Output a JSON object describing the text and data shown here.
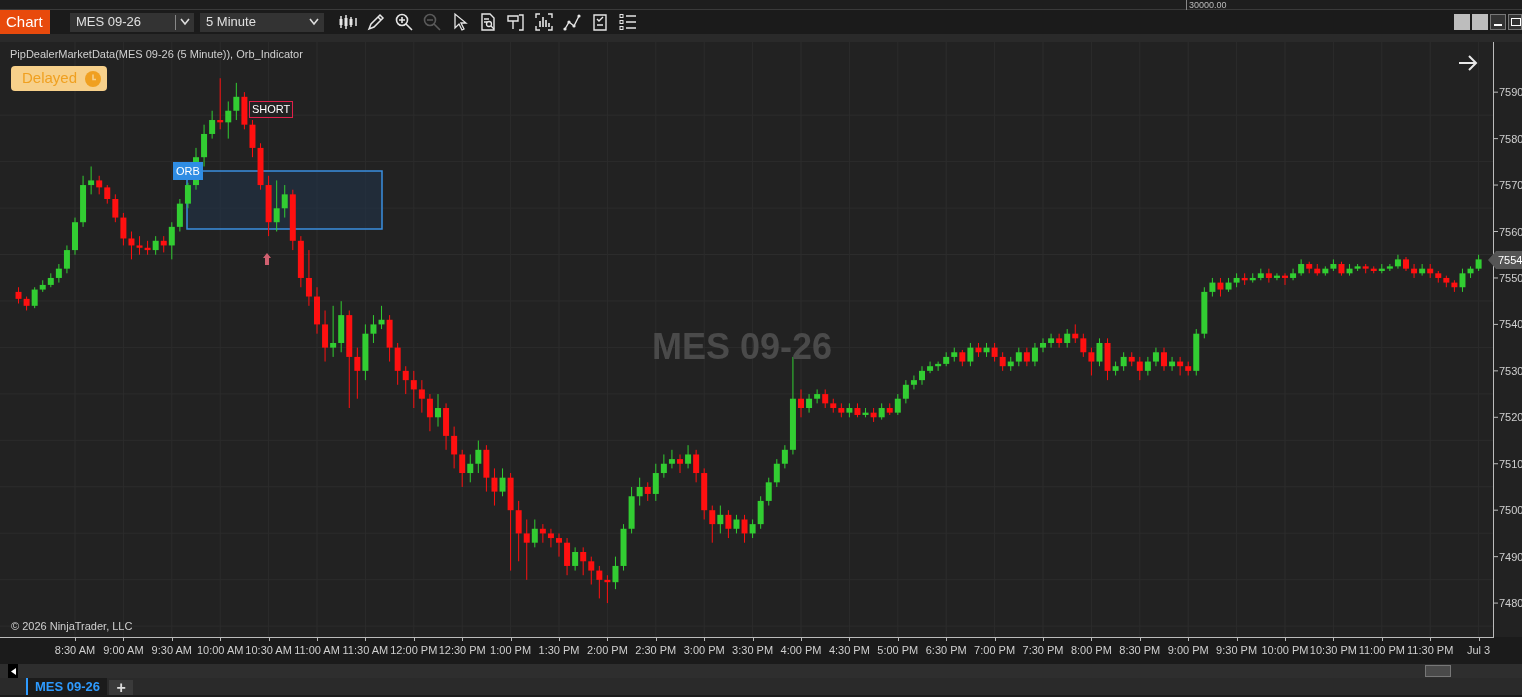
{
  "top_strip": {
    "value": "30000.00"
  },
  "toolbar": {
    "app_label": "Chart",
    "instrument": "MES 09-26",
    "interval": "5 Minute",
    "tools": [
      {
        "kind": "bars",
        "disabled": false
      },
      {
        "kind": "pencil",
        "disabled": false
      },
      {
        "kind": "zoom_in",
        "disabled": false
      },
      {
        "kind": "zoom_out",
        "disabled": true
      },
      {
        "kind": "pointer",
        "disabled": false
      },
      {
        "kind": "data_box",
        "disabled": false
      },
      {
        "kind": "properties",
        "disabled": false
      },
      {
        "kind": "templates",
        "disabled": false
      },
      {
        "kind": "strategies",
        "disabled": false
      },
      {
        "kind": "indicators",
        "disabled": false
      },
      {
        "kind": "list",
        "disabled": false
      }
    ]
  },
  "chart": {
    "title": "PipDealerMarketData(MES 09-26 (5 Minute)), Orb_Indicator",
    "status_badge": "Delayed",
    "watermark": "MES 09-26",
    "copyright": "© 2026 NinjaTrader, LLC",
    "orb_label": "ORB",
    "signal_label": "SHORT",
    "last_price": "7554",
    "chart_data": {
      "type": "candlestick",
      "ylim": [
        7472.7,
        7600.8
      ],
      "categories": [
        null,
        null,
        null,
        null,
        null,
        null,
        null,
        "8:30 AM",
        null,
        null,
        null,
        null,
        null,
        "9:00 AM",
        null,
        null,
        null,
        null,
        null,
        "9:30 AM",
        null,
        null,
        null,
        null,
        null,
        "10:00 AM",
        null,
        null,
        null,
        null,
        null,
        "10:30 AM",
        null,
        null,
        null,
        null,
        null,
        "11:00 AM",
        null,
        null,
        null,
        null,
        null,
        "11:30 AM",
        null,
        null,
        null,
        null,
        null,
        "12:00 PM",
        null,
        null,
        null,
        null,
        null,
        "12:30 PM",
        null,
        null,
        null,
        null,
        null,
        "1:00 PM",
        null,
        null,
        null,
        null,
        null,
        "1:30 PM",
        null,
        null,
        null,
        null,
        null,
        "2:00 PM",
        null,
        null,
        null,
        null,
        null,
        "2:30 PM",
        null,
        null,
        null,
        null,
        null,
        "3:00 PM",
        null,
        null,
        null,
        null,
        null,
        "3:30 PM",
        null,
        null,
        null,
        null,
        null,
        "4:00 PM",
        null,
        null,
        null,
        null,
        null,
        "4:30 PM",
        null,
        null,
        null,
        null,
        null,
        "5:00 PM",
        null,
        null,
        null,
        null,
        null,
        "6:30 PM",
        null,
        null,
        null,
        null,
        null,
        "7:00 PM",
        null,
        null,
        null,
        null,
        null,
        "7:30 PM",
        null,
        null,
        null,
        null,
        null,
        "8:00 PM",
        null,
        null,
        null,
        null,
        null,
        "8:30 PM",
        null,
        null,
        null,
        null,
        null,
        "9:00 PM",
        null,
        null,
        null,
        null,
        null,
        "9:30 PM",
        null,
        null,
        null,
        null,
        null,
        "10:00 PM",
        null,
        null,
        null,
        null,
        null,
        "10:30 PM",
        null,
        null,
        null,
        null,
        null,
        "11:00 PM",
        null,
        null,
        null,
        null,
        null,
        "11:30 PM",
        null,
        null,
        null,
        null,
        null,
        "Jul 3"
      ],
      "yticks": [
        7590,
        7580,
        7570,
        7560,
        7550,
        7540,
        7530,
        7520,
        7510,
        7500,
        7490,
        7480
      ],
      "ohlc": [
        [
          7547,
          7548,
          7544.5,
          7545.5
        ],
        [
          7545.5,
          7546,
          7543,
          7544
        ],
        [
          7544,
          7548,
          7543.5,
          7547.5
        ],
        [
          7547.5,
          7549.5,
          7547,
          7548.5
        ],
        [
          7548.5,
          7551,
          7548,
          7550
        ],
        [
          7550,
          7553,
          7549,
          7552
        ],
        [
          7552,
          7557,
          7551,
          7556
        ],
        [
          7556,
          7563,
          7555,
          7562
        ],
        [
          7562,
          7572,
          7561,
          7570
        ],
        [
          7570,
          7574,
          7568,
          7571
        ],
        [
          7571,
          7572,
          7568,
          7569.5
        ],
        [
          7569.5,
          7570,
          7566,
          7567
        ],
        [
          7567,
          7568,
          7562,
          7563
        ],
        [
          7563,
          7564,
          7557,
          7558.5
        ],
        [
          7558.5,
          7560,
          7554,
          7557
        ],
        [
          7557,
          7559,
          7555,
          7556.5
        ],
        [
          7556.5,
          7558,
          7555,
          7556
        ],
        [
          7556,
          7559,
          7555,
          7558
        ],
        [
          7558,
          7559,
          7555.5,
          7557
        ],
        [
          7557,
          7562,
          7554,
          7561
        ],
        [
          7561,
          7567,
          7560,
          7566
        ],
        [
          7566,
          7570.5,
          7565,
          7570
        ],
        [
          7570,
          7578,
          7569,
          7576
        ],
        [
          7576,
          7583,
          7574,
          7581
        ],
        [
          7581,
          7586,
          7580,
          7584
        ],
        [
          7584,
          7593,
          7582,
          7583.5
        ],
        [
          7583.5,
          7588,
          7580,
          7586
        ],
        [
          7586,
          7592,
          7584,
          7589
        ],
        [
          7589,
          7590,
          7582,
          7583
        ],
        [
          7583,
          7584,
          7576,
          7578
        ],
        [
          7578,
          7579,
          7569,
          7570
        ],
        [
          7570,
          7572,
          7559,
          7562
        ],
        [
          7562,
          7571,
          7560,
          7565
        ],
        [
          7565,
          7570,
          7563,
          7568
        ],
        [
          7568,
          7569,
          7556,
          7558
        ],
        [
          7558,
          7559,
          7548,
          7550
        ],
        [
          7550,
          7556,
          7544,
          7546
        ],
        [
          7546,
          7548,
          7538,
          7540
        ],
        [
          7540,
          7543,
          7532,
          7535
        ],
        [
          7535,
          7544,
          7533,
          7536
        ],
        [
          7536,
          7545,
          7534,
          7542
        ],
        [
          7542,
          7543,
          7522,
          7533
        ],
        [
          7533,
          7535,
          7524,
          7530
        ],
        [
          7530,
          7540,
          7528,
          7538
        ],
        [
          7538,
          7542,
          7536,
          7540
        ],
        [
          7540,
          7544,
          7539,
          7541
        ],
        [
          7541,
          7542,
          7532,
          7535
        ],
        [
          7535,
          7536,
          7527,
          7530
        ],
        [
          7530,
          7531,
          7525,
          7528
        ],
        [
          7528,
          7530,
          7522,
          7526
        ],
        [
          7526,
          7528,
          7521,
          7524
        ],
        [
          7524,
          7525,
          7517,
          7520
        ],
        [
          7520,
          7525,
          7518,
          7522
        ],
        [
          7522,
          7523,
          7513,
          7516
        ],
        [
          7516,
          7518,
          7509,
          7512
        ],
        [
          7512,
          7513,
          7505,
          7508
        ],
        [
          7508,
          7512,
          7506,
          7510
        ],
        [
          7510,
          7515,
          7508,
          7513
        ],
        [
          7513,
          7514,
          7504,
          7507
        ],
        [
          7507,
          7509,
          7501,
          7504
        ],
        [
          7504,
          7509,
          7503,
          7507
        ],
        [
          7507,
          7508,
          7487,
          7500
        ],
        [
          7500,
          7502,
          7489,
          7495
        ],
        [
          7495,
          7498,
          7485,
          7493
        ],
        [
          7493,
          7498,
          7492,
          7496
        ],
        [
          7496,
          7497,
          7493,
          7495
        ],
        [
          7495,
          7496,
          7492,
          7494
        ],
        [
          7494,
          7495,
          7490,
          7493
        ],
        [
          7493,
          7494,
          7486,
          7488
        ],
        [
          7488,
          7492,
          7487,
          7491
        ],
        [
          7491,
          7492,
          7486,
          7489
        ],
        [
          7489,
          7490,
          7484,
          7487
        ],
        [
          7487,
          7488,
          7481,
          7485
        ],
        [
          7485,
          7486,
          7480,
          7484.5
        ],
        [
          7484.5,
          7490,
          7483,
          7488
        ],
        [
          7488,
          7497,
          7487,
          7496
        ],
        [
          7496,
          7505,
          7495,
          7503
        ],
        [
          7503,
          7507,
          7501,
          7505
        ],
        [
          7505,
          7506,
          7502,
          7503.5
        ],
        [
          7503.5,
          7510,
          7502,
          7508
        ],
        [
          7508,
          7512,
          7507,
          7510
        ],
        [
          7510,
          7513,
          7509,
          7511
        ],
        [
          7511,
          7512,
          7508,
          7510
        ],
        [
          7510,
          7514,
          7509,
          7512
        ],
        [
          7512,
          7513,
          7506,
          7508
        ],
        [
          7508,
          7509,
          7498,
          7500
        ],
        [
          7500,
          7501,
          7493,
          7497
        ],
        [
          7497,
          7501,
          7495,
          7499
        ],
        [
          7499,
          7500,
          7494,
          7496
        ],
        [
          7496,
          7499,
          7495,
          7498
        ],
        [
          7498,
          7499,
          7493,
          7495
        ],
        [
          7495,
          7498,
          7494,
          7497
        ],
        [
          7497,
          7503,
          7496,
          7502
        ],
        [
          7502,
          7507,
          7501,
          7506
        ],
        [
          7506,
          7511,
          7505,
          7510
        ],
        [
          7510,
          7514,
          7509,
          7513
        ],
        [
          7513,
          7533,
          7512,
          7524
        ],
        [
          7524,
          7526,
          7520,
          7522
        ],
        [
          7522,
          7525,
          7521,
          7524
        ],
        [
          7524,
          7526,
          7523,
          7525
        ],
        [
          7525,
          7526,
          7522,
          7523
        ],
        [
          7523,
          7524,
          7521,
          7522
        ],
        [
          7522,
          7523,
          7520,
          7521
        ],
        [
          7521,
          7523,
          7520,
          7522
        ],
        [
          7522,
          7523,
          7520,
          7520.5
        ],
        [
          7520.5,
          7522,
          7520,
          7521
        ],
        [
          7521,
          7522,
          7519,
          7520
        ],
        [
          7520,
          7523,
          7519.5,
          7522
        ],
        [
          7522,
          7523,
          7520.5,
          7521
        ],
        [
          7521,
          7525,
          7520.5,
          7524
        ],
        [
          7524,
          7528,
          7523,
          7527
        ],
        [
          7527,
          7529,
          7526,
          7528
        ],
        [
          7528,
          7531,
          7527,
          7530
        ],
        [
          7530,
          7532,
          7529.5,
          7531
        ],
        [
          7531,
          7532,
          7530,
          7531.5
        ],
        [
          7531.5,
          7534,
          7531,
          7533
        ],
        [
          7533,
          7535,
          7532,
          7534
        ],
        [
          7534,
          7534.5,
          7531,
          7532
        ],
        [
          7532,
          7536,
          7531,
          7535
        ],
        [
          7535,
          7536,
          7533,
          7534
        ],
        [
          7534,
          7536,
          7533,
          7535
        ],
        [
          7535,
          7536,
          7532,
          7533
        ],
        [
          7533,
          7534,
          7530,
          7531
        ],
        [
          7531,
          7533,
          7530,
          7532
        ],
        [
          7532,
          7535,
          7531,
          7534
        ],
        [
          7534,
          7535,
          7531,
          7532
        ],
        [
          7532,
          7536,
          7531,
          7535
        ],
        [
          7535,
          7537,
          7534,
          7536
        ],
        [
          7536,
          7538,
          7535,
          7537
        ],
        [
          7537,
          7538,
          7535,
          7536
        ],
        [
          7536,
          7539,
          7535,
          7538
        ],
        [
          7538,
          7540,
          7536,
          7537
        ],
        [
          7537,
          7538,
          7533,
          7534
        ],
        [
          7534,
          7535,
          7529,
          7532
        ],
        [
          7532,
          7537,
          7531,
          7536
        ],
        [
          7536,
          7537,
          7528,
          7530
        ],
        [
          7530,
          7532,
          7529,
          7531
        ],
        [
          7531,
          7534,
          7530,
          7533
        ],
        [
          7533,
          7534,
          7531,
          7532
        ],
        [
          7532,
          7533,
          7528,
          7530
        ],
        [
          7530,
          7533,
          7529,
          7532
        ],
        [
          7532,
          7535,
          7531,
          7534
        ],
        [
          7534,
          7535,
          7530,
          7531
        ],
        [
          7531,
          7533,
          7530,
          7532
        ],
        [
          7532,
          7533,
          7529,
          7531
        ],
        [
          7531,
          7532,
          7529,
          7530
        ],
        [
          7530,
          7539,
          7529,
          7538
        ],
        [
          7538,
          7548,
          7537,
          7547
        ],
        [
          7547,
          7550,
          7546,
          7549
        ],
        [
          7549,
          7550,
          7546,
          7547.5
        ],
        [
          7547.5,
          7550,
          7547,
          7549
        ],
        [
          7549,
          7551,
          7548,
          7550
        ],
        [
          7550,
          7551,
          7548.5,
          7549.5
        ],
        [
          7549.5,
          7551,
          7549,
          7550
        ],
        [
          7550,
          7552,
          7549.5,
          7551
        ],
        [
          7551,
          7552,
          7549,
          7550
        ],
        [
          7550,
          7551,
          7549.5,
          7550.5
        ],
        [
          7550.5,
          7551,
          7548.5,
          7550
        ],
        [
          7550,
          7552,
          7549.5,
          7551
        ],
        [
          7551,
          7554,
          7550.5,
          7553
        ],
        [
          7553,
          7553.5,
          7551,
          7552
        ],
        [
          7552,
          7553,
          7550.5,
          7551
        ],
        [
          7551,
          7552.5,
          7550.5,
          7552
        ],
        [
          7552,
          7554,
          7551.5,
          7553
        ],
        [
          7553,
          7553.5,
          7550.5,
          7551
        ],
        [
          7551,
          7553,
          7550.5,
          7552
        ],
        [
          7552,
          7553,
          7551.5,
          7552.5
        ],
        [
          7552.5,
          7553,
          7551,
          7552
        ],
        [
          7552,
          7552.5,
          7551,
          7551.5
        ],
        [
          7551.5,
          7553,
          7551,
          7552
        ],
        [
          7552,
          7553,
          7551.5,
          7552.5
        ],
        [
          7552.5,
          7555,
          7552,
          7554
        ],
        [
          7554,
          7554.5,
          7551.5,
          7552
        ],
        [
          7552,
          7553,
          7550,
          7551
        ],
        [
          7551,
          7553,
          7550.5,
          7552
        ],
        [
          7552,
          7553,
          7550,
          7551
        ],
        [
          7551,
          7551.5,
          7549,
          7550
        ],
        [
          7550,
          7550.5,
          7548,
          7549
        ],
        [
          7549,
          7549.5,
          7547,
          7548
        ],
        [
          7548,
          7552,
          7547,
          7551
        ],
        [
          7551,
          7552.5,
          7550,
          7552
        ],
        [
          7552,
          7555,
          7551.5,
          7554
        ]
      ]
    }
  },
  "tabs": [
    {
      "label": "MES 09-26",
      "selected": true
    }
  ],
  "add_tab": "+"
}
